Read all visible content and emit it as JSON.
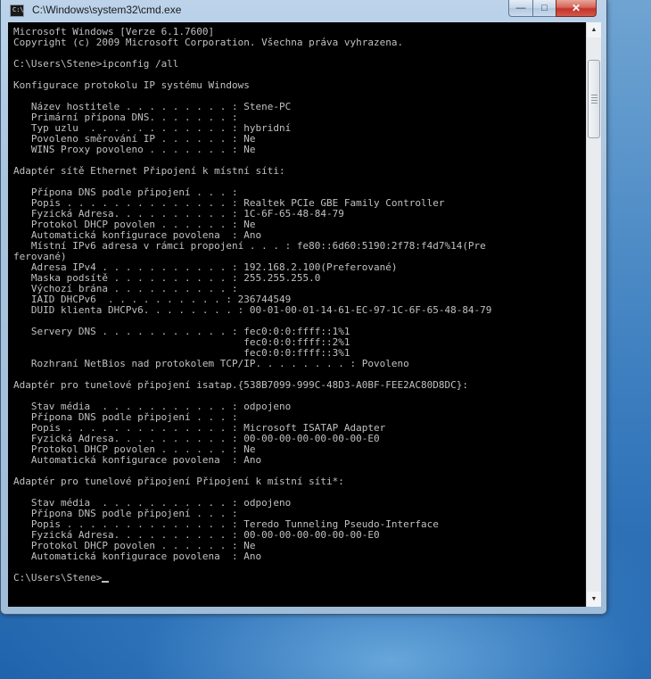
{
  "window": {
    "title": "C:\\Windows\\system32\\cmd.exe",
    "icon_text": "C:\\",
    "caption_buttons": {
      "minimize_icon": "minimize-icon",
      "maximize_icon": "maximize-icon",
      "close_icon": "close-icon",
      "minimize_glyph": "—",
      "maximize_glyph": "□",
      "close_glyph": "✕"
    }
  },
  "console": {
    "text_color": "#c0c0c0",
    "background": "#000000",
    "lines": [
      "Microsoft Windows [Verze 6.1.7600]",
      "Copyright (c) 2009 Microsoft Corporation. Všechna práva vyhrazena.",
      "",
      "C:\\Users\\Stene>ipconfig /all",
      "",
      "Konfigurace protokolu IP systému Windows",
      "",
      "   Název hostitele . . . . . . . . . : Stene-PC",
      "   Primární přípona DNS. . . . . . . :",
      "   Typ uzlu  . . . . . . . . . . . . : hybridní",
      "   Povoleno směrování IP . . . . . . : Ne",
      "   WINS Proxy povoleno . . . . . . . : Ne",
      "",
      "Adaptér sítě Ethernet Připojení k místní síti:",
      "",
      "   Přípona DNS podle připojení . . . :",
      "   Popis . . . . . . . . . . . . . . : Realtek PCIe GBE Family Controller",
      "   Fyzická Adresa. . . . . . . . . . : 1C-6F-65-48-84-79",
      "   Protokol DHCP povolen . . . . . . : Ne",
      "   Automatická konfigurace povolena  : Ano",
      "   Místní IPv6 adresa v rámci propojení . . . : fe80::6d60:5190:2f78:f4d7%14(Pre",
      "ferované)",
      "   Adresa IPv4 . . . . . . . . . . . : 192.168.2.100(Preferované)",
      "   Maska podsítě . . . . . . . . . . : 255.255.255.0",
      "   Výchozí brána . . . . . . . . . . :",
      "   IAID DHCPv6  . . . . . . . . . . : 236744549",
      "   DUID klienta DHCPv6. . . . . . . . : 00-01-00-01-14-61-EC-97-1C-6F-65-48-84-79",
      "",
      "   Servery DNS . . . . . . . . . . . : fec0:0:0:ffff::1%1",
      "                                       fec0:0:0:ffff::2%1",
      "                                       fec0:0:0:ffff::3%1",
      "   Rozhraní NetBios nad protokolem TCP/IP. . . . . . . . : Povoleno",
      "",
      "Adaptér pro tunelové připojení isatap.{538B7099-999C-48D3-A0BF-FEE2AC80D8DC}:",
      "",
      "   Stav média  . . . . . . . . . . . : odpojeno",
      "   Přípona DNS podle připojení . . . :",
      "   Popis . . . . . . . . . . . . . . : Microsoft ISATAP Adapter",
      "   Fyzická Adresa. . . . . . . . . . : 00-00-00-00-00-00-00-E0",
      "   Protokol DHCP povolen . . . . . . : Ne",
      "   Automatická konfigurace povolena  : Ano",
      "",
      "Adaptér pro tunelové připojení Připojení k místní síti*:",
      "",
      "   Stav média  . . . . . . . . . . . : odpojeno",
      "   Přípona DNS podle připojení . . . :",
      "   Popis . . . . . . . . . . . . . . : Teredo Tunneling Pseudo-Interface",
      "   Fyzická Adresa. . . . . . . . . . : 00-00-00-00-00-00-00-E0",
      "   Protokol DHCP povolen . . . . . . : Ne",
      "   Automatická konfigurace povolena  : Ano",
      "",
      "C:\\Users\\Stene>"
    ]
  },
  "scrollbar": {
    "up_icon": "scroll-up-arrow-icon",
    "down_icon": "scroll-down-arrow-icon",
    "up_glyph": "▲",
    "down_glyph": "▼"
  }
}
